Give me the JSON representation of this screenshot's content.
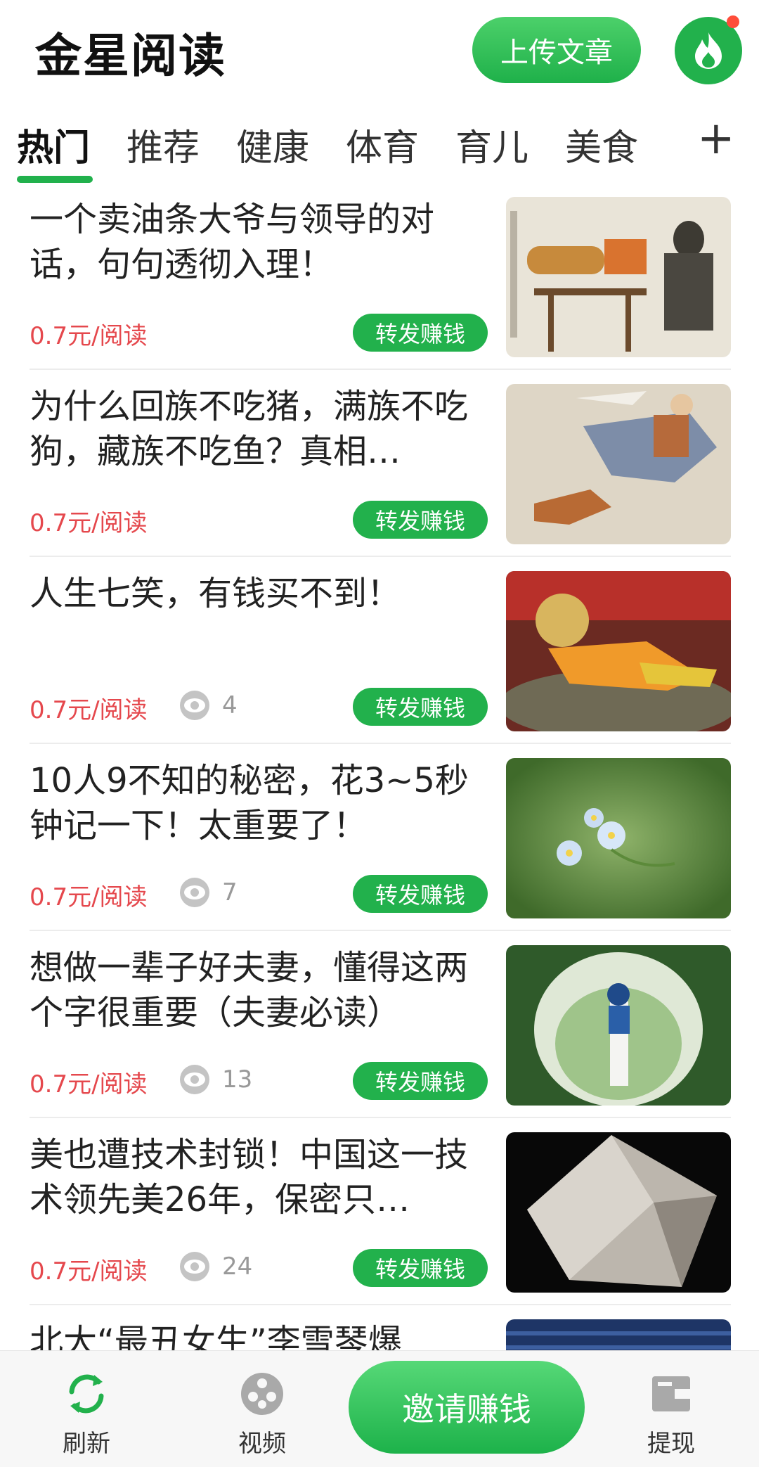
{
  "header": {
    "title": "金星阅读",
    "upload_label": "上传文章"
  },
  "tabs": {
    "items": [
      "热门",
      "推荐",
      "健康",
      "体育",
      "育儿",
      "美食"
    ],
    "plus": "+"
  },
  "feed": {
    "items": [
      {
        "title": "一个卖油条大爷与领导的对话，句句透彻入理！",
        "price": "0.7元/阅读",
        "views": "",
        "share": "转发赚钱"
      },
      {
        "title": "为什么回族不吃猪，满族不吃狗，藏族不吃鱼？真相…",
        "price": "0.7元/阅读",
        "views": "",
        "share": "转发赚钱"
      },
      {
        "title": "人生七笑，有钱买不到！",
        "price": "0.7元/阅读",
        "views": "4",
        "share": "转发赚钱"
      },
      {
        "title": "10人9不知的秘密，花3~5秒钟记一下！太重要了！",
        "price": "0.7元/阅读",
        "views": "7",
        "share": "转发赚钱"
      },
      {
        "title": "想做一辈子好夫妻，懂得这两个字很重要（夫妻必读）",
        "price": "0.7元/阅读",
        "views": "13",
        "share": "转发赚钱"
      },
      {
        "title": "美也遭技术封锁！中国这一技术领先美26年，保密只…",
        "price": "0.7元/阅读",
        "views": "24",
        "share": "转发赚钱"
      },
      {
        "title": "北大“最丑女生”李雪琴爆",
        "price": "",
        "views": "",
        "share": ""
      }
    ]
  },
  "bottom_nav": {
    "refresh": "刷新",
    "video": "视频",
    "invite": "邀请赚钱",
    "withdraw": "提现"
  },
  "colors": {
    "accent": "#22b14c",
    "price": "#e5484d",
    "muted": "#999999"
  }
}
